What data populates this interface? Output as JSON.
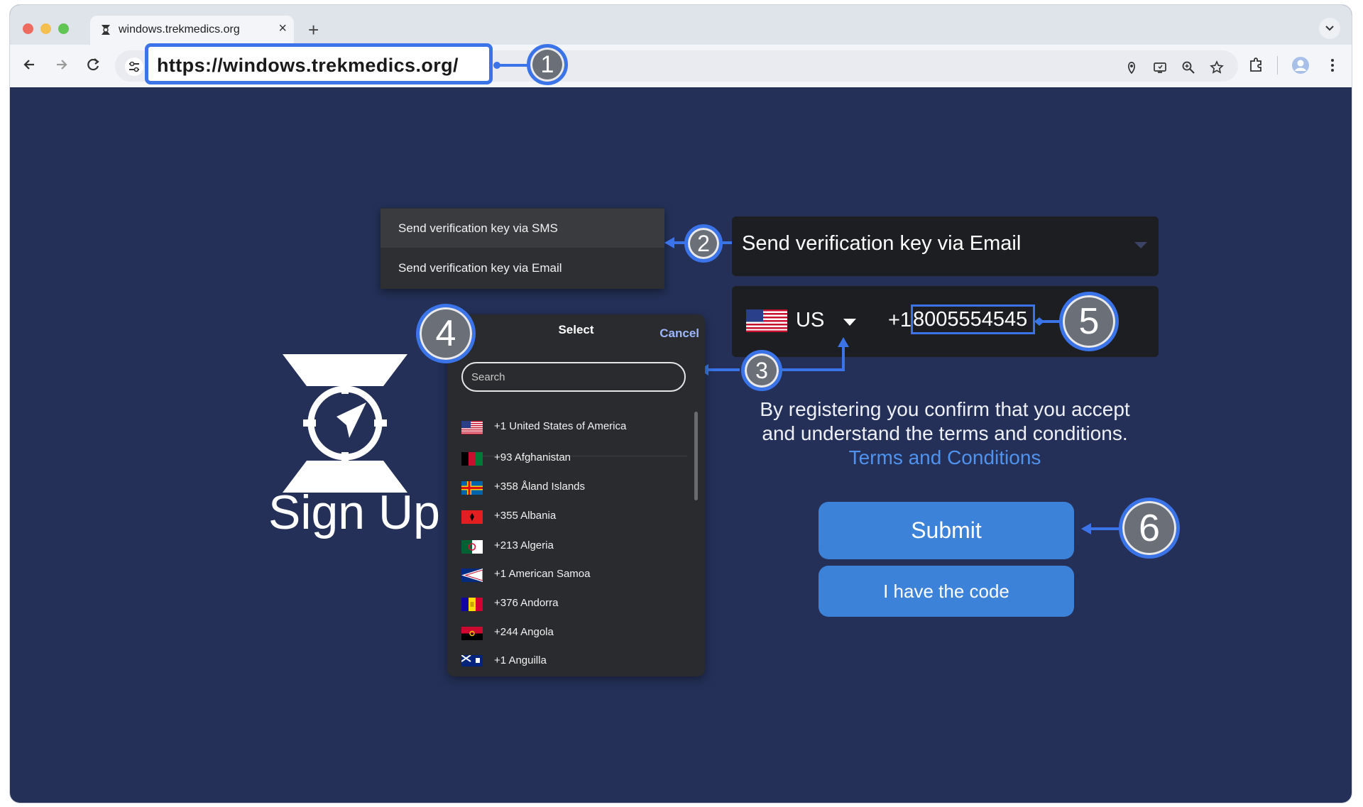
{
  "browser": {
    "tab_title": "windows.trekmedics.org",
    "new_tab_symbol": "+",
    "url": "https://windows.trekmedics.org/",
    "traffic_light_colors": [
      "#ed6a5e",
      "#f5bf4f",
      "#61c554"
    ]
  },
  "verification_menu": {
    "items": [
      {
        "label": "Send verification key via SMS"
      },
      {
        "label": "Send verification key via Email"
      }
    ],
    "selected_value": "Send verification key via Email"
  },
  "phone": {
    "country_code": "US",
    "prefix": "+1",
    "number": "8005554545"
  },
  "country_select": {
    "title": "Select",
    "cancel_label": "Cancel",
    "search_placeholder": "Search",
    "countries": [
      {
        "label": "+1 United States of America",
        "flag": "us"
      },
      {
        "label": "+93 Afghanistan",
        "flag": "af"
      },
      {
        "label": "+358 Åland Islands",
        "flag": "ax"
      },
      {
        "label": "+355 Albania",
        "flag": "al"
      },
      {
        "label": "+213 Algeria",
        "flag": "dz"
      },
      {
        "label": "+1 American Samoa",
        "flag": "as"
      },
      {
        "label": "+376 Andorra",
        "flag": "ad"
      },
      {
        "label": "+244 Angola",
        "flag": "ao"
      },
      {
        "label": "+1 Anguilla",
        "flag": "ai"
      }
    ]
  },
  "signup": {
    "title": "Sign Up"
  },
  "terms": {
    "text": "By registering you confirm that you accept and understand the terms and conditions.",
    "link_label": "Terms and Conditions"
  },
  "buttons": {
    "submit_label": "Submit",
    "have_code_label": "I have the code"
  },
  "annotations": {
    "labels": [
      "1",
      "2",
      "3",
      "4",
      "5",
      "6"
    ],
    "accent_color": "#3a74e8"
  },
  "colors": {
    "page_background": "#243058",
    "button": "#3d82d9",
    "link": "#4f93ef"
  }
}
